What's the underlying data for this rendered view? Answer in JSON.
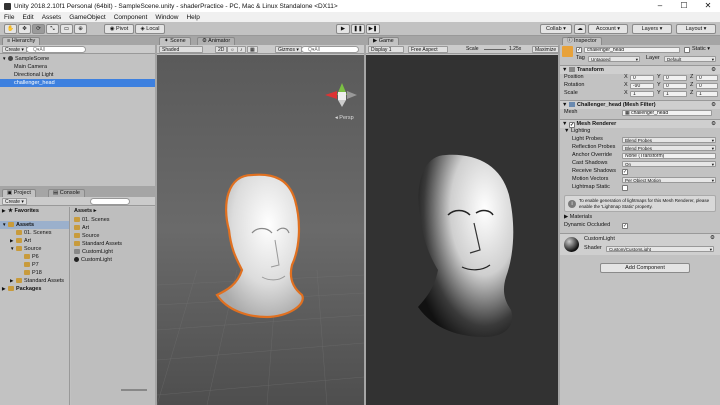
{
  "window": {
    "title": "Unity 2018.2.10f1 Personal (64bit) - SampleScene.unity - shaderPractice - PC, Mac & Linux Standalone <DX11>"
  },
  "menu": [
    "File",
    "Edit",
    "Assets",
    "GameObject",
    "Component",
    "Window",
    "Help"
  ],
  "toolbar": {
    "pivot": "Pivot",
    "local": "Local",
    "collab": "Collab ▾",
    "account": "Account ▾",
    "layers": "Layers ▾",
    "layout": "Layout ▾"
  },
  "hierarchy": {
    "tab": "Hierarchy",
    "create": "Create ▾",
    "search_placeholder": "Q▾All",
    "scene": "SampleScene",
    "items": [
      "Main Camera",
      "Directional Light",
      "challenger_head"
    ]
  },
  "scene": {
    "tab": "Scene",
    "tab2": "Animator",
    "shaded": "Shaded",
    "mode2d": "2D",
    "gizmos": "Gizmos ▾",
    "search_placeholder": "Q▾All",
    "persp": "◂ Persp"
  },
  "game": {
    "tab": "Game",
    "display": "Display 1",
    "aspect": "Free Aspect",
    "scale_label": "Scale",
    "scale_value": "1.25x",
    "maximize": "Maximize"
  },
  "project": {
    "tab": "Project",
    "tab2": "Console",
    "create": "Create ▾",
    "favorites": "Favorites",
    "assets_root": "Assets",
    "tree": [
      "01. Scenes",
      "Art",
      "Source",
      "P6",
      "P7",
      "P18",
      "Standard Assets"
    ],
    "packages": "Packages",
    "breadcrumb": "Assets ▸",
    "files": [
      "01. Scenes",
      "Art",
      "Source",
      "Standard Assets",
      "CustomLight",
      "CustomLight"
    ]
  },
  "inspector": {
    "tab": "Inspector",
    "object_name": "challenger_head",
    "static": "Static ▾",
    "tag_label": "Tag",
    "tag": "Untagged",
    "layer_label": "Layer",
    "layer": "Default",
    "transform": {
      "title": "Transform",
      "rows": [
        {
          "label": "Position",
          "x": "0",
          "y": "0",
          "z": "0"
        },
        {
          "label": "Rotation",
          "x": "-90",
          "y": "0",
          "z": "0"
        },
        {
          "label": "Scale",
          "x": "1",
          "y": "1",
          "z": "1"
        }
      ]
    },
    "mesh_filter": {
      "title": "Challenger_head (Mesh Filter)",
      "mesh_label": "Mesh",
      "mesh": "challenger_head"
    },
    "mesh_renderer": {
      "title": "Mesh Renderer",
      "lighting": "Lighting",
      "rows": [
        {
          "label": "Light Probes",
          "value": "Blend Probes"
        },
        {
          "label": "Reflection Probes",
          "value": "Blend Probes"
        },
        {
          "label": "Anchor Override",
          "value": "None (Transform)"
        },
        {
          "label": "Cast Shadows",
          "value": "On"
        },
        {
          "label": "Receive Shadows",
          "value": "✓"
        },
        {
          "label": "Motion Vectors",
          "value": "Per Object Motion"
        },
        {
          "label": "Lightmap Static",
          "value": ""
        }
      ],
      "info": "To enable generation of lightmaps for this Mesh Renderer, please enable the 'Lightmap Static' property.",
      "materials": "Materials",
      "dynamic_occluded": "Dynamic Occluded"
    },
    "material": {
      "name": "CustomLight",
      "shader_label": "Shader",
      "shader": "Custom/CustomLight"
    },
    "add_component": "Add Component"
  }
}
